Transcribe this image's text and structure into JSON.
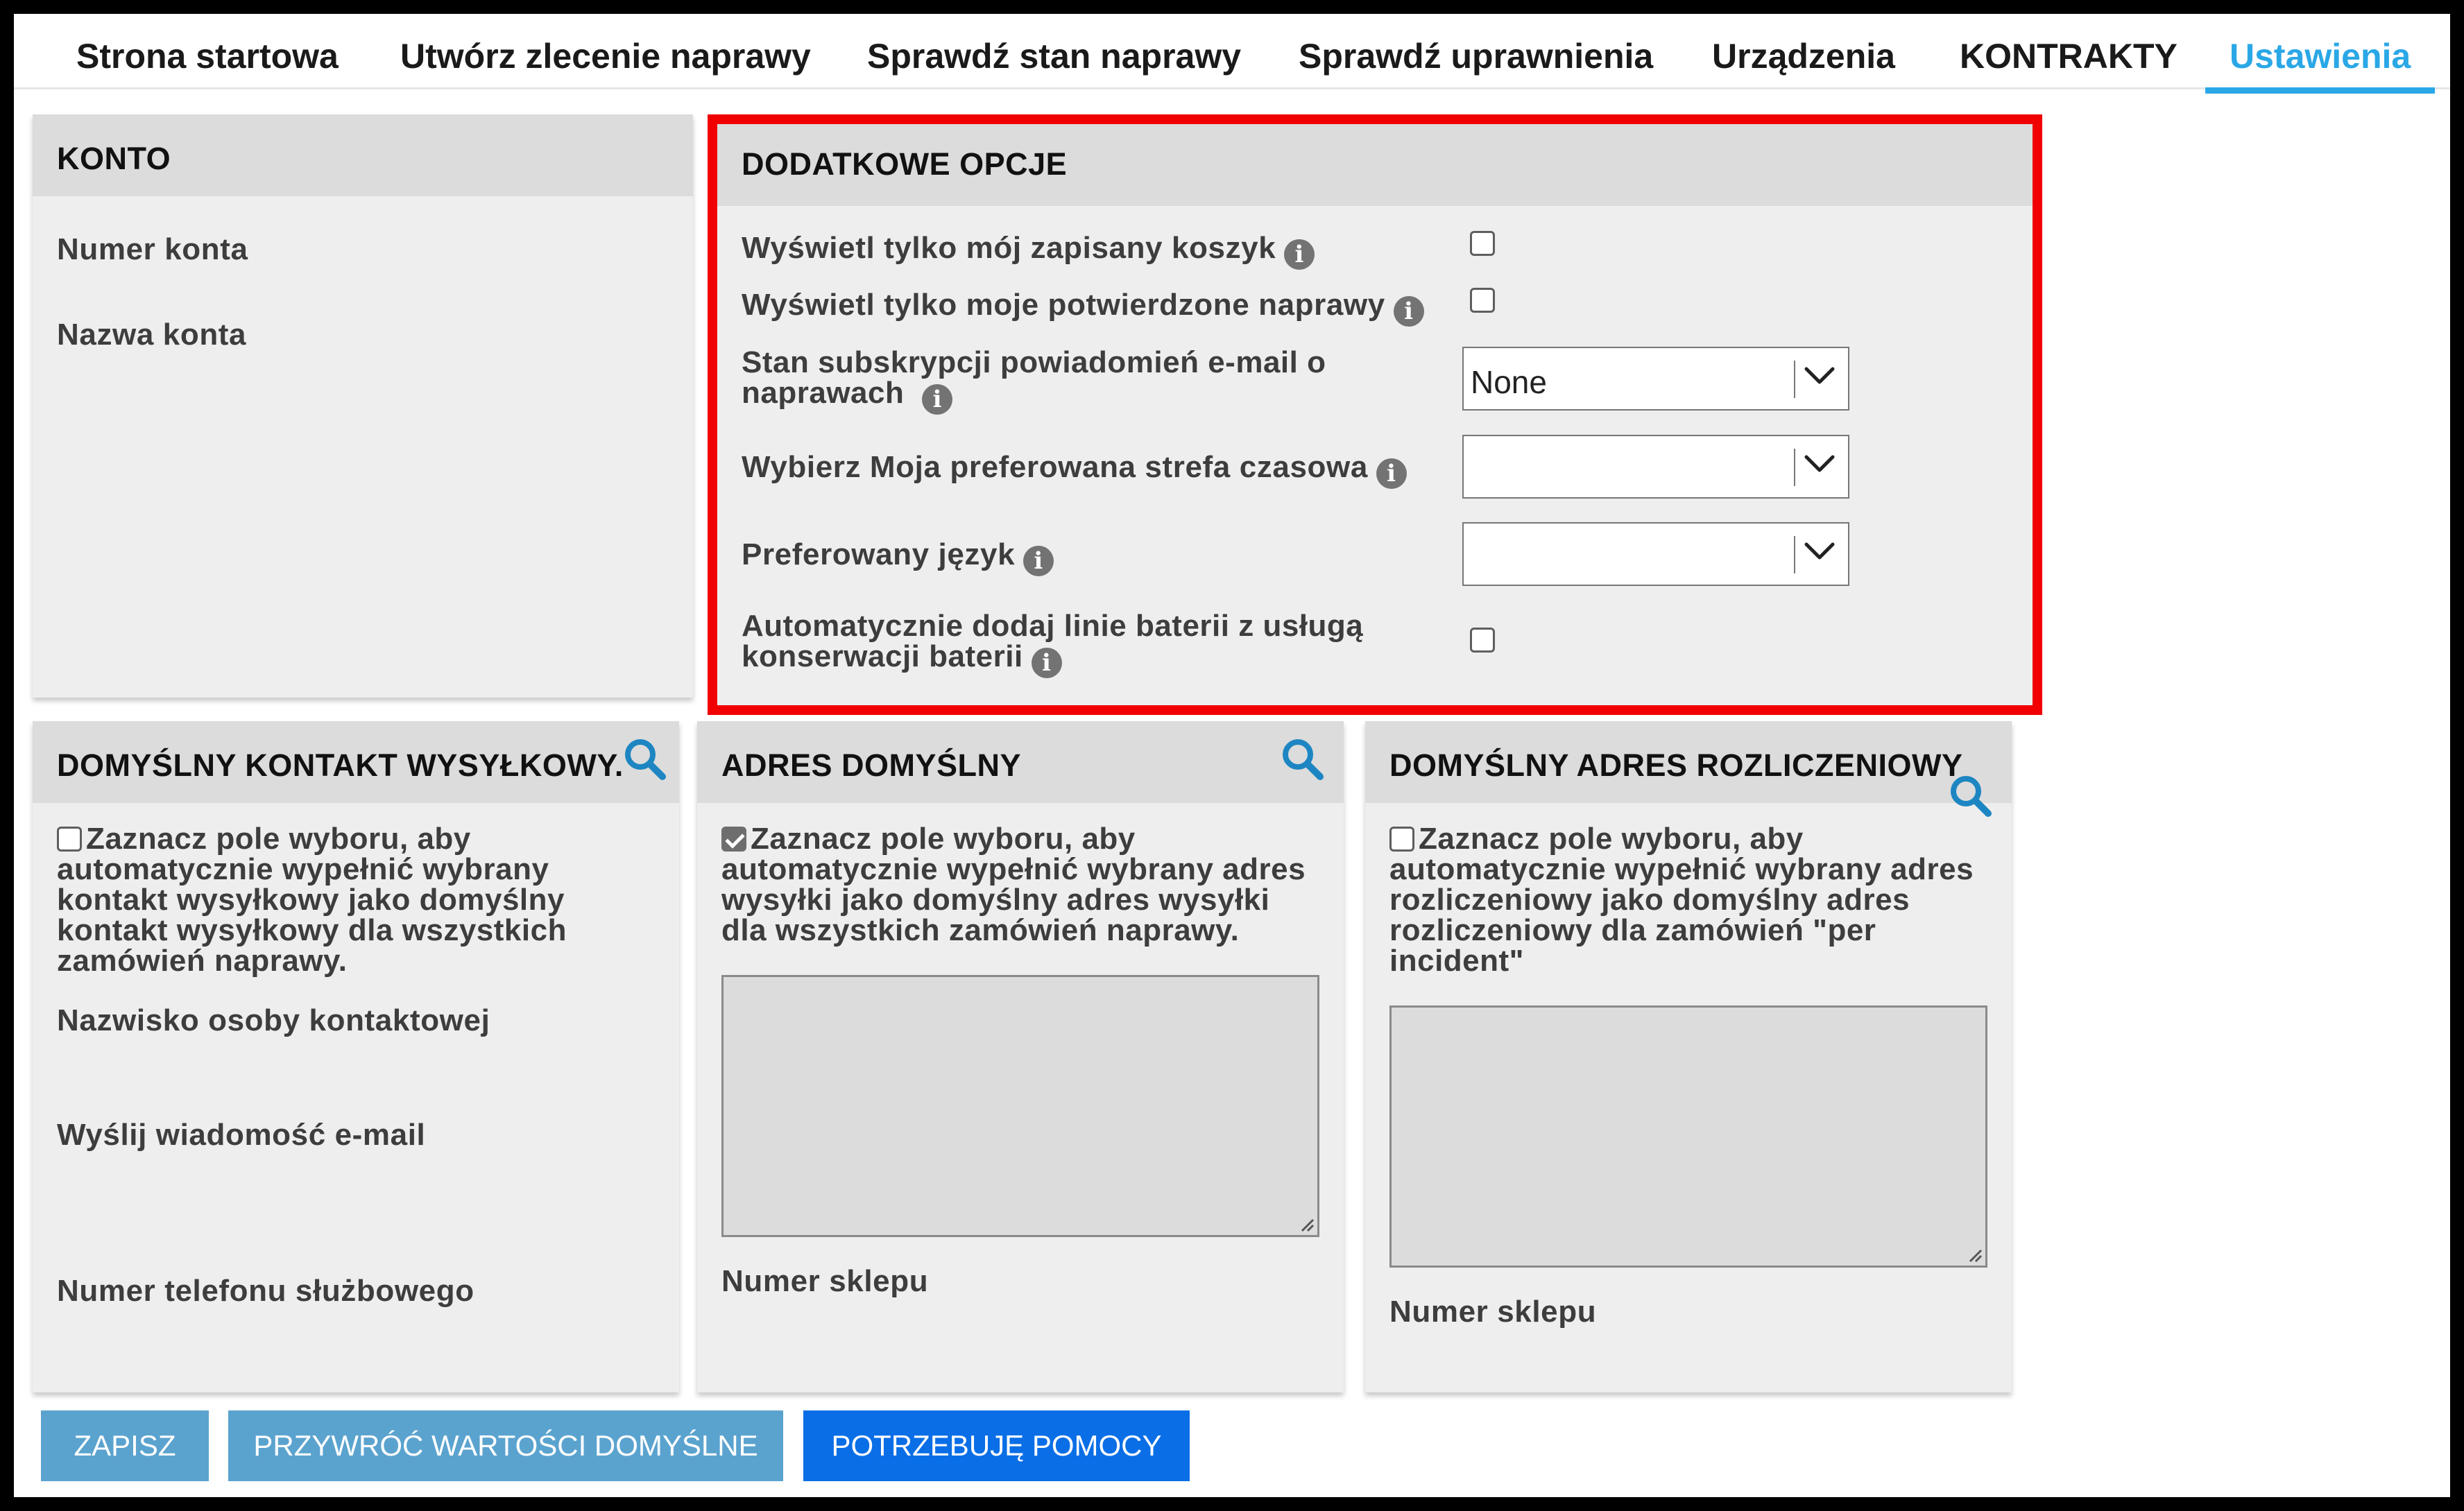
{
  "nav": {
    "tabs": [
      {
        "label": "Strona startowa"
      },
      {
        "label": "Utwórz zlecenie naprawy"
      },
      {
        "label": "Sprawdź stan naprawy"
      },
      {
        "label": "Sprawdź uprawnienia"
      },
      {
        "label": "Urządzenia"
      },
      {
        "label": "KONTRAKTY"
      },
      {
        "label": "Ustawienia",
        "active": true
      }
    ]
  },
  "konto": {
    "title": "KONTO",
    "account_number_label": "Numer konta",
    "account_name_label": "Nazwa konta"
  },
  "options": {
    "title": "DODATKOWE OPCJE",
    "saved_cart": {
      "label": "Wyświetl tylko mój zapisany koszyk",
      "checked": false
    },
    "confirmed_repairs": {
      "label": "Wyświetl tylko moje potwierdzone naprawy",
      "checked": false
    },
    "email_subscription": {
      "label_line1": "Stan subskrypcji powiadomień e-mail o",
      "label_line2": "naprawach",
      "value": "None"
    },
    "timezone": {
      "label": "Wybierz Moja preferowana strefa czasowa",
      "value": ""
    },
    "language": {
      "label": "Preferowany język",
      "value": ""
    },
    "battery": {
      "label_line1": "Automatycznie dodaj linie baterii z usługą",
      "label_line2": "konserwacji baterii",
      "checked": false
    }
  },
  "shipping_contact": {
    "title": "DOMYŚLNY KONTAKT WYSYŁKOWY.",
    "checked": false,
    "desc_line1": "Zaznacz pole wyboru, aby",
    "desc_line2": "automatycznie wypełnić wybrany",
    "desc_line3": "kontakt wysyłkowy jako domyślny",
    "desc_line4": "kontakt wysyłkowy dla wszystkich",
    "desc_line5": "zamówień naprawy.",
    "contact_name_label": "Nazwisko osoby kontaktowej",
    "email_label": "Wyślij wiadomość e-mail",
    "phone_label": "Numer telefonu służbowego"
  },
  "default_address": {
    "title": "ADRES DOMYŚLNY",
    "checked": true,
    "desc_line1": "Zaznacz pole wyboru, aby",
    "desc_line2": "automatycznie wypełnić wybrany adres",
    "desc_line3": "wysyłki jako domyślny adres wysyłki",
    "desc_line4": "dla wszystkich zamówień naprawy.",
    "store_label": "Numer sklepu"
  },
  "billing_address": {
    "title": "DOMYŚLNY ADRES ROZLICZENIOWY",
    "checked": false,
    "desc_line1": "Zaznacz pole wyboru, aby",
    "desc_line2": "automatycznie wypełnić wybrany adres",
    "desc_line3": "rozliczeniowy jako domyślny adres",
    "desc_line4": "rozliczeniowy dla zamówień \"per",
    "desc_line5": "incident\"",
    "store_label": "Numer sklepu"
  },
  "buttons": {
    "save": "ZAPISZ",
    "restore": "PRZYWRÓĆ WARTOŚCI DOMYŚLNE",
    "help": "POTRZEBUJĘ POMOCY"
  },
  "colors": {
    "accent": "#2aa7e6",
    "highlight": "#f00000",
    "button_muted": "#5ba3cf",
    "button_primary": "#0a6ee6",
    "search_icon": "#1d86c2"
  }
}
